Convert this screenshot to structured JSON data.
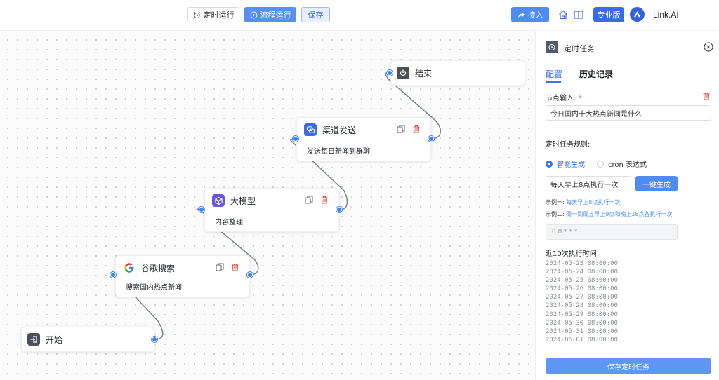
{
  "toolbar": {
    "timer_run_label": "定时运行",
    "flow_run_label": "流程运行",
    "save_label": "保存",
    "access_label": "接入",
    "pro_label": "专业版",
    "brand_name": "Link.AI"
  },
  "nodes": {
    "end": {
      "title": "结束"
    },
    "channel": {
      "title": "渠道发送",
      "desc": "发送每日新闻到群聊"
    },
    "llm": {
      "title": "大模型",
      "desc": "内容整理"
    },
    "google": {
      "title": "谷歌搜索",
      "desc": "搜索国内热点新闻"
    },
    "start": {
      "title": "开始"
    }
  },
  "panel": {
    "title": "定时任务",
    "tabs": {
      "config": "配置",
      "history": "历史记录"
    },
    "node_input_label": "节点输入:",
    "required_mark": "*",
    "node_input_value": "今日国内十大热点新闻是什么",
    "rule_label": "定时任务规则:",
    "radio_smart": "智能生成",
    "radio_cron": "cron 表达式",
    "smart_input_value": "每天早上8点执行一次",
    "generate_button": "一键生成",
    "example1_label": "示例一:",
    "example1_text": "每天早上8点执行一次",
    "example2_label": "示例二:",
    "example2_text": "周一到周五早上9点和晚上18点各执行一次",
    "cron_value": "0 8 * * *",
    "recent_label": "近10次执行时间",
    "recent_times": [
      "2024-05-23 08:00:00",
      "2024-05-24 08:00:00",
      "2024-05-25 08:00:00",
      "2024-05-26 08:00:00",
      "2024-05-27 08:00:00",
      "2024-05-28 08:00:00",
      "2024-05-29 08:00:00",
      "2024-05-30 08:00:00",
      "2024-05-31 08:00:00",
      "2024-06-01 08:00:00"
    ],
    "save_task_button": "保存定时任务"
  },
  "colors": {
    "accent": "#3a72e8",
    "primary_button": "#4f8cf1",
    "pro_badge": "#3d6be5",
    "delete_red": "#e0443a",
    "port_blue": "#3b82f6"
  }
}
